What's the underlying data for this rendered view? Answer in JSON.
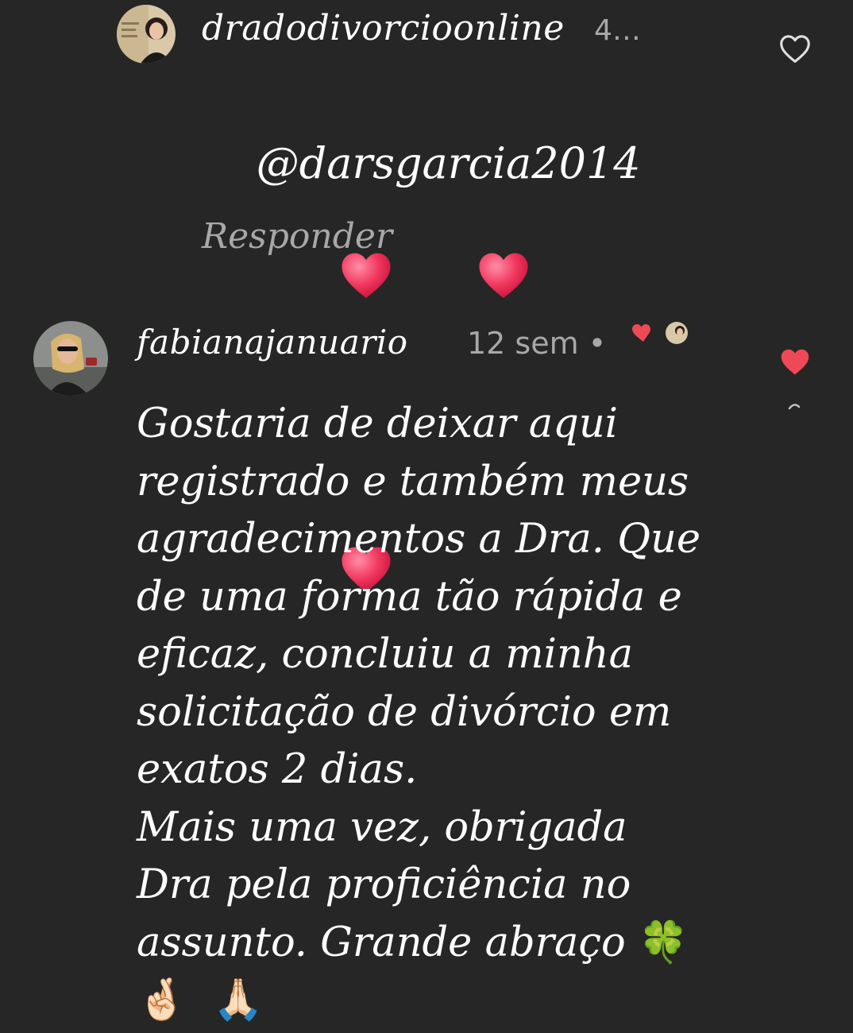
{
  "comments": [
    {
      "username": "dradodivorcioonline",
      "age": "4…",
      "mention": "@darsgarcia2014",
      "reply_label": "Responder",
      "liked": false,
      "avatar_icon": "profile-photo-icon"
    },
    {
      "username": "fabianajanuario",
      "age": "12 sem",
      "separator": "•",
      "text_lines": [
        "Gostaria de deixar aqui",
        "registrado e também meus",
        "agradecimentos a Dra. Que",
        "de uma forma tão rápida e",
        "eficaz, concluiu a minha",
        "solicitação de divórcio em",
        "exatos 2 dias.",
        "Mais uma vez, obrigada",
        "Dra pela proficiência no",
        "assunto. Grande abraço"
      ],
      "end_emojis": [
        "🍀",
        "🤞🏻",
        "🙏🏻"
      ],
      "liked": true,
      "liked_by_author_icon": "creator-heart-icon",
      "avatar_icon": "profile-photo-icon"
    }
  ],
  "colors": {
    "background": "#262626",
    "text": "#ffffff",
    "secondary": "#a8a8a8",
    "like_red": "#ed4956"
  }
}
